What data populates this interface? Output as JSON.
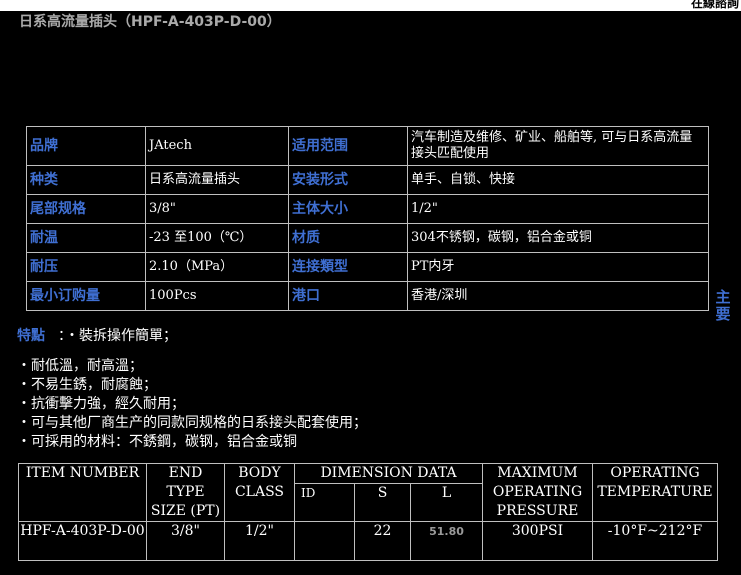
{
  "header": {
    "topbar_text": "在線諮詢",
    "page_title": "日系高流量插头（HPF-A-403P-D-00）",
    "side_tab": "主要"
  },
  "spec_table": {
    "rows": [
      [
        "品牌",
        "JAtech",
        "适用范围",
        "汽车制造及维修、矿业、船舶等, 可与日系高流量接头匹配使用"
      ],
      [
        "种类",
        "日系高流量插头",
        "安装形式",
        "单手、自锁、快接"
      ],
      [
        "尾部规格",
        "3/8\"",
        "主体大小",
        "1/2\""
      ],
      [
        "耐温",
        "-23 至100（℃）",
        "材质",
        "304不锈钢，碳钢，铝合金或铜"
      ],
      [
        "耐压",
        "2.10（MPa）",
        "连接類型",
        "PT内牙"
      ],
      [
        "最小订购量",
        "100Pcs",
        "港口",
        "香港/深圳"
      ]
    ]
  },
  "features": {
    "label": "特點",
    "first": "：・裝拆操作簡單；",
    "items": [
      "・耐低溫，耐高溫；",
      "・不易生銹，耐腐蝕；",
      "・抗衝擊力強，經久耐用；",
      "・可与其他厂商生产的同款同规格的日系接头配套使用；",
      "・可採用的材料：不銹鋼，碳钢，铝合金或铜"
    ]
  },
  "dimension_table": {
    "headers": {
      "item_number": "ITEM NUMBER",
      "end_type_size": "END TYPE SIZE (PT)",
      "body_class": "BODY CLASS",
      "dimension_data": "DIMENSION DATA",
      "id": "ID",
      "s": "S",
      "l": "L",
      "max_pressure": "MAXIMUM OPERATING PRESSURE",
      "operating_temp": "OPERATING TEMPERATURE"
    },
    "row": {
      "item_number": "HPF-A-403P-D-00",
      "end_type_size": "3/8\"",
      "body_class": "1/2\"",
      "id": "",
      "s": "22",
      "l": "51.80",
      "max_pressure": "300PSI",
      "operating_temp": "-10°F~212°F"
    }
  },
  "colors": {
    "background": "#000000",
    "key_label": "#3f6fd2",
    "title": "#aaaaaa",
    "border": "#bfbfbf"
  }
}
